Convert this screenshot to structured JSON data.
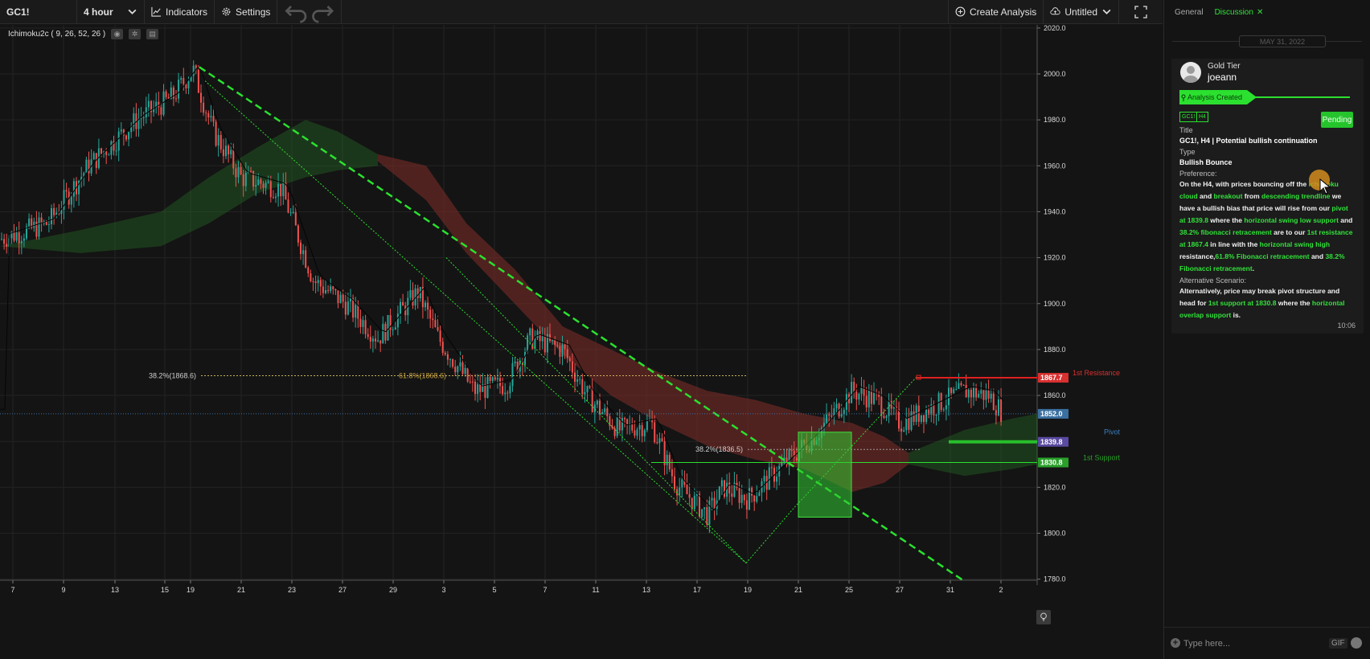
{
  "toolbar": {
    "symbol": "GC1!",
    "interval": "4 hour",
    "indicators_label": "Indicators",
    "settings_label": "Settings",
    "create_analysis_label": "Create Analysis",
    "layout_name": "Untitled"
  },
  "chart": {
    "indicator_legend": "Ichimoku2c ( 9, 26, 52, 26 )",
    "price_axis": [
      "2020.0",
      "2000.0",
      "1980.0",
      "1960.0",
      "1940.0",
      "1920.0",
      "1900.0",
      "1880.0",
      "1860.0",
      "1840.0",
      "1820.0",
      "1800.0",
      "1780.0"
    ],
    "time_axis": [
      "7",
      "9",
      "13",
      "15",
      "19",
      "21",
      "23",
      "27",
      "29",
      "3",
      "5",
      "7",
      "11",
      "13",
      "17",
      "19",
      "21",
      "25",
      "27",
      "31",
      "2"
    ],
    "price_tags": [
      {
        "value": "1867.7",
        "color": "#d93030"
      },
      {
        "value": "1852.0",
        "color": "#3a6fa0"
      },
      {
        "value": "1839.8",
        "color": "#5a4aa0"
      },
      {
        "value": "1830.8",
        "color": "#2aa02a"
      }
    ],
    "annotations": {
      "fib_382_left": "38.2%(1868.6)",
      "fib_618": "61.8%(1868.6)",
      "fib_382_mid": "38.2%(1836.5)",
      "first_resistance": "1st Resistance",
      "pivot": "Pivot",
      "first_support": "1st Support"
    },
    "colors": {
      "bull_candle": "#26a69a",
      "bear_candle": "#ef5350",
      "trendline": "#2be02f",
      "resistance": "#e02020",
      "support": "#2be02f"
    }
  },
  "panel": {
    "tabs": [
      "General",
      "Discussion"
    ],
    "active_tab": "Discussion",
    "date_separator": "MAY 31, 2022",
    "message": {
      "tier": "Gold Tier",
      "username": "joeann",
      "banner": "Analysis Created",
      "tags": [
        "GC1!",
        "H4"
      ],
      "status": "Pending",
      "title_label": "Title",
      "title_value": "GC1!, H4 | Potential bullish continuation",
      "type_label": "Type",
      "type_value": "Bullish Bounce",
      "preference_label": "Preference:",
      "preference": {
        "p1": "On the H4, with prices bouncing off the ",
        "h1": "ichimoku cloud",
        "p2": " and ",
        "h2": "breakout",
        "p3": " from ",
        "h3": "descending trendline",
        "p4": " we have a bullish bias that price will rise from our ",
        "h4": "pivot at 1839.8",
        "p5": " where the ",
        "h5": "horizontal swing low support",
        "p6": " and ",
        "h6": "38.2% fibonacci retracement",
        "p7": " are to our ",
        "h7": "1st resistance at 1867.4",
        "p8": " in line with the ",
        "h8": "horizontal swing high",
        "p9": " resistance,",
        "h9": "61.8% Fibonacci retracement",
        "p10": " and ",
        "h10": "38.2% Fibonacci retracement",
        "p11": "."
      },
      "alternative_label": "Alternative Scenario:",
      "alternative": {
        "p1": "Alternatively, price may break pivot structure and head for ",
        "h1": "1st support at 1830.8",
        "p2": " where the ",
        "h2": "horizontal overlap support",
        "p3": " is."
      },
      "time": "10:06"
    },
    "composer_placeholder": "Type here...",
    "gif_label": "GIF"
  }
}
